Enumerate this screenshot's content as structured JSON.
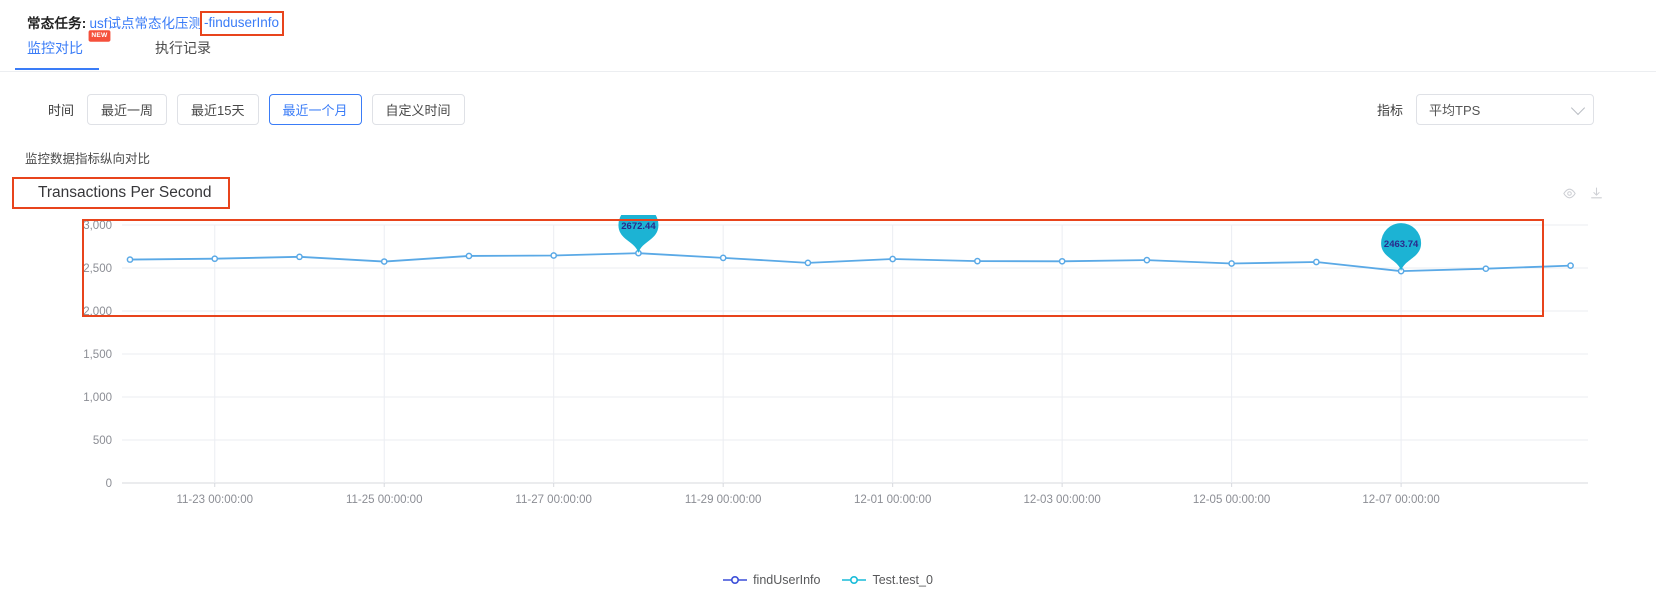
{
  "header": {
    "title_prefix": "常态任务:",
    "title_link": "usf试点常态化压测",
    "title_link_highlight": "-finduserInfo"
  },
  "tabs": [
    {
      "label": "监控对比",
      "badge": "NEW",
      "active": true
    },
    {
      "label": "执行记录",
      "badge": "",
      "active": false
    }
  ],
  "filters": {
    "time_label": "时间",
    "time_options": [
      {
        "label": "最近一周",
        "selected": false
      },
      {
        "label": "最近15天",
        "selected": false
      },
      {
        "label": "最近一个月",
        "selected": true
      },
      {
        "label": "自定义时间",
        "selected": false
      }
    ],
    "metric_label": "指标",
    "metric_value": "平均TPS",
    "metric_options": [
      "平均TPS"
    ]
  },
  "section": {
    "label": "监控数据指标纵向对比"
  },
  "chart_header": {
    "title": "Transactions Per Second",
    "eye_icon": "eye-icon",
    "download_icon": "download-icon"
  },
  "colors": {
    "accent_blue": "#3a7cf7",
    "highlight_red": "#e8441c",
    "series_line": "#5aa9e6",
    "marker_teal": "#1cb3d4",
    "legend_indigo": "#3c4fd8",
    "legend_cyan": "#19bcd9",
    "axis_text": "#8b8d94",
    "grid": "#ebedf2"
  },
  "chart_data": {
    "type": "line",
    "title": "Transactions Per Second",
    "xlabel": "",
    "ylabel": "",
    "ylim": [
      0,
      3000
    ],
    "yticks": [
      0,
      500,
      1000,
      1500,
      2000,
      2500,
      3000
    ],
    "ytick_labels": [
      "0",
      "500",
      "1,000",
      "1,500",
      "2,000",
      "2,500",
      "3,000"
    ],
    "grid": true,
    "legend_position": "bottom",
    "xtick_labels": [
      "11-23 00:00:00",
      "11-25 00:00:00",
      "11-27 00:00:00",
      "11-29 00:00:00",
      "12-01 00:00:00",
      "12-03 00:00:00",
      "12-05 00:00:00",
      "12-07 00:00:00"
    ],
    "series": [
      {
        "name": "findUserInfo",
        "color": "#3c4fd8",
        "values": []
      },
      {
        "name": "Test.test_0",
        "color": "#19bcd9",
        "line_color": "#5aa9e6",
        "x": [
          0,
          1,
          2,
          3,
          4,
          5,
          6,
          7,
          8,
          9,
          10,
          11,
          12,
          13,
          14,
          15,
          16,
          17
        ],
        "values": [
          2598,
          2608,
          2630,
          2575,
          2640,
          2645,
          2672.44,
          2618,
          2560,
          2605,
          2580,
          2578,
          2592,
          2552,
          2570,
          2463.74,
          2492,
          2528
        ]
      }
    ],
    "annotations": [
      {
        "label": "2672.44",
        "series": "Test.test_0",
        "x_index": 6,
        "value": 2672.44
      },
      {
        "label": "2463.74",
        "series": "Test.test_0",
        "x_index": 15,
        "value": 2463.74
      }
    ]
  },
  "legend": [
    {
      "label": "findUserInfo",
      "color": "#3c4fd8"
    },
    {
      "label": "Test.test_0",
      "color": "#19bcd9"
    }
  ]
}
